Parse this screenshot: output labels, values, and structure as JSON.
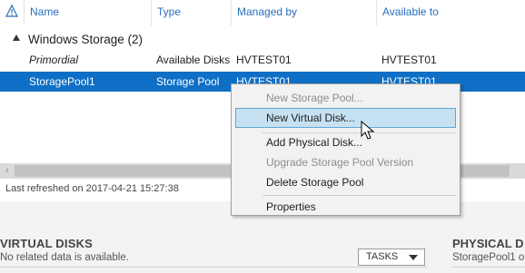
{
  "columns": {
    "name": "Name",
    "type": "Type",
    "managed_by": "Managed by",
    "available_to": "Available to"
  },
  "group": {
    "label": "Windows Storage (2)"
  },
  "rows": [
    {
      "name": "Primordial",
      "type": "Available Disks",
      "managed_by": "HVTEST01",
      "available_to": "HVTEST01",
      "selected": false
    },
    {
      "name": "StoragePool1",
      "type": "Storage Pool",
      "managed_by": "HVTEST01",
      "available_to": "HVTEST01",
      "selected": true
    }
  ],
  "status": {
    "refresh_text": "Last refreshed on 2017-04-21 15:27:38"
  },
  "context_menu": {
    "items": [
      {
        "label": "New Storage Pool...",
        "enabled": false
      },
      {
        "label": "New Virtual Disk...",
        "enabled": true,
        "highlighted": true
      },
      {
        "label": "Add Physical Disk...",
        "enabled": true
      },
      {
        "label": "Upgrade Storage Pool Version",
        "enabled": false
      },
      {
        "label": "Delete Storage Pool",
        "enabled": true
      },
      {
        "label": "Properties",
        "enabled": true
      }
    ]
  },
  "virtual_disks": {
    "title": "VIRTUAL DISKS",
    "note": "No related data is available.",
    "tasks_label": "TASKS"
  },
  "physical_disks": {
    "title": "PHYSICAL D",
    "note": "StoragePool1 o"
  },
  "icons": {
    "warning": "warning-triangle-icon",
    "expand": "collapse-triangle-icon",
    "cursor": "mouse-pointer-icon",
    "dropdown": "chevron-down-icon"
  },
  "colors": {
    "header_text": "#2a6ebb",
    "selection": "#0f6fc6",
    "menu_highlight": "#c6e2f2"
  }
}
